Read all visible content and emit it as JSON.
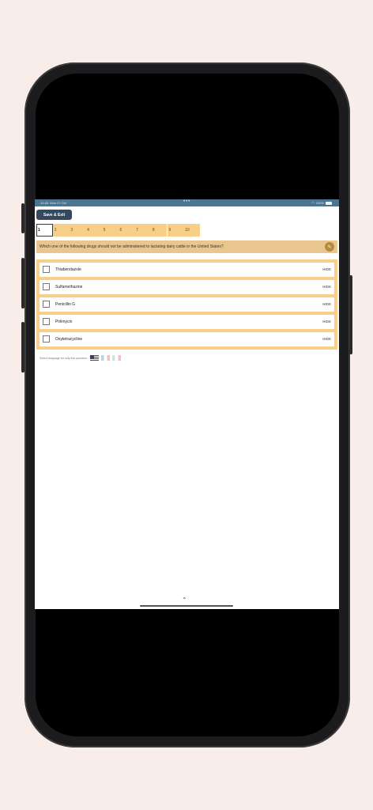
{
  "status": {
    "time": "14:45",
    "date": "Mon 27 Oct",
    "battery": "100%"
  },
  "toolbar": {
    "save_label": "Save & Exit"
  },
  "question_nav": [
    "1",
    "2",
    "3",
    "4",
    "5",
    "6",
    "7",
    "8",
    "9",
    "10"
  ],
  "active_question": "1",
  "question": {
    "text": "Which one of the following drugs should not be administered to lactating dairy cattle in the United States?"
  },
  "options": [
    {
      "label": "Thiabendazole",
      "hide": "HIDE"
    },
    {
      "label": "Sulfamethazine",
      "hide": "HIDE"
    },
    {
      "label": "Penicillin G",
      "hide": "HIDE"
    },
    {
      "label": "Pirlimycin",
      "hide": "HIDE"
    },
    {
      "label": "Oxytetracycline",
      "hide": "HIDE"
    }
  ],
  "language": {
    "prompt": "Select language for only this question:"
  },
  "colors": {
    "accent": "#f7cf88",
    "question_bg": "#e9c68e",
    "save_button": "#34495e",
    "statusbar": "#4d7590"
  }
}
